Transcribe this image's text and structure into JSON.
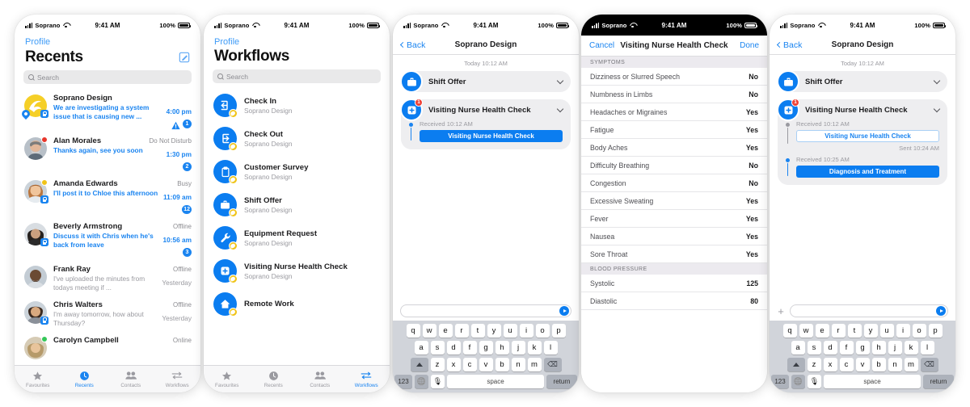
{
  "colors": {
    "accent": "#0b7df0",
    "link": "#1a84f0",
    "alert": "#ef4136",
    "brandYellow": "#f0c419",
    "muted": "#9a9aa0"
  },
  "status_bar": {
    "carrier": "Soprano",
    "time": "9:41 AM",
    "battery": "100%"
  },
  "phone1": {
    "profile": "Profile",
    "title": "Recents",
    "search_placeholder": "Search",
    "items": [
      {
        "name": "Soprano Design",
        "status": "",
        "message": "We are investigating a system issue that is causing new ...",
        "time": "4:00 pm",
        "badge": "1",
        "warn": true,
        "unread": true,
        "presence": "",
        "lock": true,
        "pin": true,
        "avatar": "brand"
      },
      {
        "name": "Alan Morales",
        "status": "Do Not Disturb",
        "message": "Thanks again, see you soon",
        "time": "1:30 pm",
        "badge": "2",
        "warn": false,
        "unread": true,
        "presence": "#e8362b",
        "lock": false,
        "pin": false,
        "avatar": "alan"
      },
      {
        "name": "Amanda Edwards",
        "status": "Busy",
        "message": "I'll post it to Chloe this afternoon",
        "time": "11:09 am",
        "badge": "12",
        "warn": false,
        "unread": true,
        "presence": "#f0c419",
        "lock": true,
        "pin": false,
        "avatar": "amanda"
      },
      {
        "name": "Beverly Armstrong",
        "status": "Offline",
        "message": "Discuss it with Chris when he's back from leave",
        "time": "10:56 am",
        "badge": "3",
        "warn": false,
        "unread": true,
        "presence": "",
        "lock": true,
        "pin": false,
        "avatar": "beverly"
      },
      {
        "name": "Frank Ray",
        "status": "Offline",
        "message": "I've uploaded the minutes from todays meeting if ...",
        "time": "Yesterday",
        "badge": "",
        "warn": false,
        "unread": false,
        "presence": "",
        "lock": false,
        "pin": false,
        "avatar": "frank"
      },
      {
        "name": "Chris Walters",
        "status": "Offline",
        "message": "I'm away tomorrow, how about Thursday?",
        "time": "Yesterday",
        "badge": "",
        "warn": false,
        "unread": false,
        "presence": "",
        "lock": true,
        "pin": false,
        "avatar": "chris"
      },
      {
        "name": "Carolyn Campbell",
        "status": "Online",
        "message": "",
        "time": "",
        "badge": "",
        "warn": false,
        "unread": false,
        "presence": "#34c759",
        "lock": false,
        "pin": false,
        "avatar": "carolyn"
      }
    ],
    "tabs": [
      {
        "label": "Favourites",
        "icon": "star-icon",
        "active": false
      },
      {
        "label": "Recents",
        "icon": "clock-icon",
        "active": true
      },
      {
        "label": "Contacts",
        "icon": "people-icon",
        "active": false
      },
      {
        "label": "Workflows",
        "icon": "arrows-icon",
        "active": false
      }
    ]
  },
  "phone2": {
    "profile": "Profile",
    "title": "Workflows",
    "search_placeholder": "Search",
    "items": [
      {
        "name": "Check In",
        "org": "Soprano Design",
        "icon": "check-in-icon"
      },
      {
        "name": "Check Out",
        "org": "Soprano Design",
        "icon": "check-out-icon"
      },
      {
        "name": "Customer Survey",
        "org": "Soprano Design",
        "icon": "clipboard-icon"
      },
      {
        "name": "Shift Offer",
        "org": "Soprano Design",
        "icon": "briefcase-icon"
      },
      {
        "name": "Equipment Request",
        "org": "Soprano Design",
        "icon": "wrench-icon"
      },
      {
        "name": "Visiting Nurse Health Check",
        "org": "Soprano Design",
        "icon": "medical-cross-icon"
      },
      {
        "name": "Remote Work",
        "org": "",
        "icon": "home-icon"
      }
    ],
    "tabs": [
      {
        "label": "Favourites",
        "icon": "star-icon",
        "active": false
      },
      {
        "label": "Recents",
        "icon": "clock-icon",
        "active": false
      },
      {
        "label": "Contacts",
        "icon": "people-icon",
        "active": false
      },
      {
        "label": "Workflows",
        "icon": "arrows-icon",
        "active": true
      }
    ]
  },
  "phone3": {
    "back": "Back",
    "title": "Soprano Design",
    "day_stamp": "Today 10:12 AM",
    "cards": [
      {
        "title": "Shift Offer",
        "icon": "briefcase-icon",
        "alert": "",
        "thread": []
      },
      {
        "title": "Visiting Nurse Health Check",
        "icon": "medical-cross-icon",
        "alert": "1",
        "thread": [
          {
            "label": "Received 10:12 AM",
            "button": "Visiting Nurse Health Check",
            "style": "filled",
            "state": "active",
            "sent": ""
          }
        ]
      }
    ],
    "keyboard": {
      "row1": [
        "q",
        "w",
        "e",
        "r",
        "t",
        "y",
        "u",
        "i",
        "o",
        "p"
      ],
      "row2": [
        "a",
        "s",
        "d",
        "f",
        "g",
        "h",
        "j",
        "k",
        "l"
      ],
      "row3": [
        "z",
        "x",
        "c",
        "v",
        "b",
        "n",
        "m"
      ],
      "num": "123",
      "space": "space",
      "return": "return"
    }
  },
  "phone4": {
    "cancel": "Cancel",
    "title": "Visiting Nurse Health Check",
    "done": "Done",
    "sections": [
      {
        "header": "SYMPTOMS",
        "rows": [
          {
            "label": "Dizziness or Slurred Speech",
            "value": "No"
          },
          {
            "label": "Numbness in Limbs",
            "value": "No"
          },
          {
            "label": "Headaches or Migraines",
            "value": "Yes"
          },
          {
            "label": "Fatigue",
            "value": "Yes"
          },
          {
            "label": "Body Aches",
            "value": "Yes"
          },
          {
            "label": "Difficulty Breathing",
            "value": "No"
          },
          {
            "label": "Congestion",
            "value": "No"
          },
          {
            "label": "Excessive Sweating",
            "value": "Yes"
          },
          {
            "label": "Fever",
            "value": "Yes"
          },
          {
            "label": "Nausea",
            "value": "Yes"
          },
          {
            "label": "Sore Throat",
            "value": "Yes"
          }
        ]
      },
      {
        "header": "BLOOD PRESSURE",
        "rows": [
          {
            "label": "Systolic",
            "value": "125"
          },
          {
            "label": "Diastolic",
            "value": "80"
          }
        ]
      }
    ]
  },
  "phone5": {
    "back": "Back",
    "title": "Soprano Design",
    "day_stamp": "Today 10:12 AM",
    "cards": [
      {
        "title": "Shift Offer",
        "icon": "briefcase-icon",
        "alert": "",
        "thread": []
      },
      {
        "title": "Visiting Nurse Health Check",
        "icon": "medical-cross-icon",
        "alert": "1",
        "thread": [
          {
            "label": "Received 10:12 AM",
            "button": "Visiting Nurse Health Check",
            "style": "outline",
            "state": "done",
            "sent": "Sent 10:24 AM"
          },
          {
            "label": "Received 10:25 AM",
            "button": "Diagnosis and Treatment",
            "style": "filled",
            "state": "active",
            "sent": ""
          }
        ]
      }
    ],
    "keyboard": {
      "row1": [
        "q",
        "w",
        "e",
        "r",
        "t",
        "y",
        "u",
        "i",
        "o",
        "p"
      ],
      "row2": [
        "a",
        "s",
        "d",
        "f",
        "g",
        "h",
        "j",
        "k",
        "l"
      ],
      "row3": [
        "z",
        "x",
        "c",
        "v",
        "b",
        "n",
        "m"
      ],
      "num": "123",
      "space": "space",
      "return": "return"
    }
  }
}
